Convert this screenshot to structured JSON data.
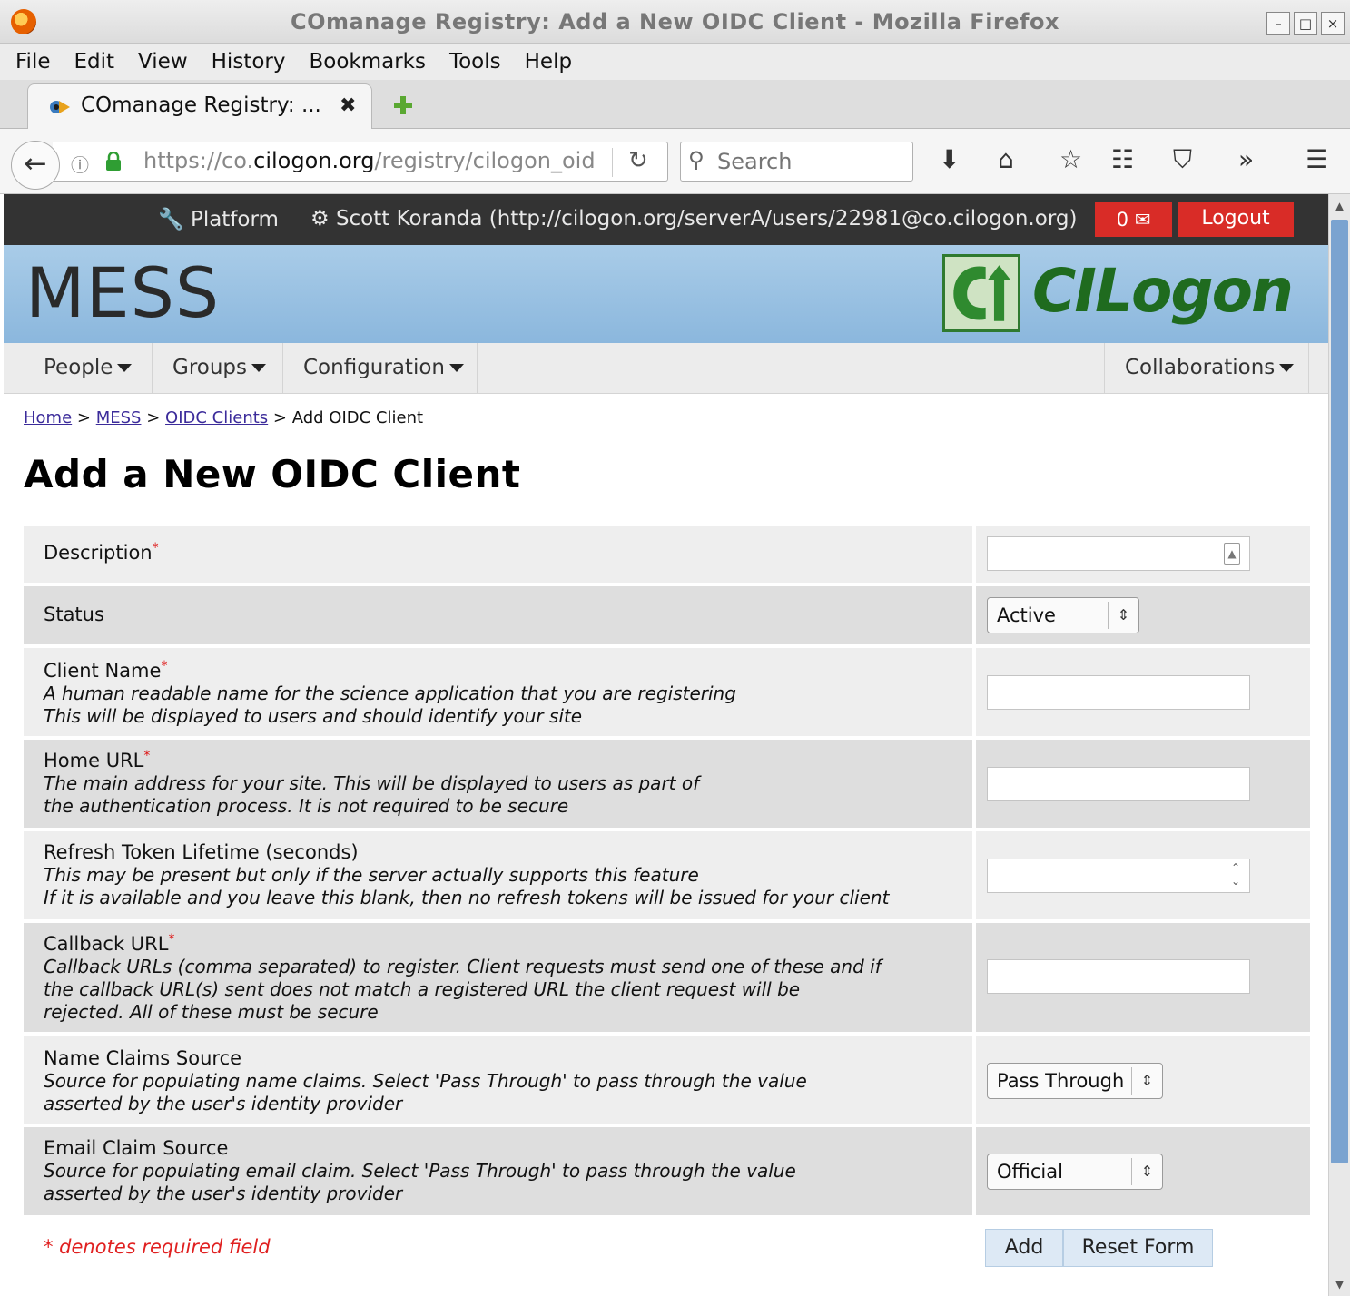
{
  "window": {
    "title": "COmanage Registry: Add a New OIDC Client - Mozilla Firefox",
    "buttons": [
      "–",
      "□",
      "×"
    ]
  },
  "menu": [
    "File",
    "Edit",
    "View",
    "History",
    "Bookmarks",
    "Tools",
    "Help"
  ],
  "tab": {
    "title": "COmanage Registry: ...",
    "close": "✖"
  },
  "address": {
    "url_prefix": "https://co.",
    "url_domain": "cilogon.org",
    "url_path": "/registry/cilogon_oid"
  },
  "search": {
    "placeholder": "Search"
  },
  "toolbar_icons": [
    "download-icon",
    "home-icon",
    "bookmark-star-icon",
    "reader-list-icon",
    "pocket-icon",
    "overflow-chevron-icon",
    "hamburger-menu-icon"
  ],
  "topbar": {
    "platform": "Platform",
    "user": "Scott Koranda (http://cilogon.org/serverA/users/22981@co.cilogon.org)",
    "notifications": "0",
    "logout": "Logout"
  },
  "banner": {
    "co_name": "MESS",
    "logo_text": "CILogon"
  },
  "nav": {
    "people": "People",
    "groups": "Groups",
    "configuration": "Configuration",
    "collaborations": "Collaborations"
  },
  "breadcrumb": {
    "home": "Home",
    "mess": "MESS",
    "oidc": "OIDC Clients",
    "current": "Add OIDC Client",
    "sep": ">"
  },
  "page_title": "Add a New OIDC Client",
  "form": {
    "description": {
      "label": "Description"
    },
    "status": {
      "label": "Status",
      "value": "Active"
    },
    "client_name": {
      "label": "Client Name",
      "desc1": "A human readable name for the science application that you are registering",
      "desc2": "This will be displayed to users and should identify your site"
    },
    "home_url": {
      "label": "Home URL",
      "desc1": "The main address for your site. This will be displayed to users as part of",
      "desc2": "the authentication process. It is not required to be secure"
    },
    "refresh": {
      "label": "Refresh Token Lifetime (seconds)",
      "desc1": "This may be present but only if the server actually supports this feature",
      "desc2": "If it is available and you leave this blank, then no refresh tokens will be issued for your client"
    },
    "callback": {
      "label": "Callback URL",
      "desc1": "Callback URLs (comma separated) to register. Client requests must send one of these and if",
      "desc2": "the callback URL(s) sent does not match a registered URL the client request will be",
      "desc3": "rejected. All of these must be secure"
    },
    "name_claims": {
      "label": "Name Claims Source",
      "desc1": "Source for populating name claims. Select 'Pass Through' to pass through the value",
      "desc2": "asserted by the user's identity provider",
      "value": "Pass Through"
    },
    "email_claim": {
      "label": "Email Claim Source",
      "desc1": "Source for populating email claim. Select 'Pass Through' to pass through the value",
      "desc2": "asserted by the user's identity provider",
      "value": "Official"
    },
    "required_marker": "*",
    "required_note": "* denotes required field",
    "add": "Add",
    "reset": "Reset Form"
  }
}
